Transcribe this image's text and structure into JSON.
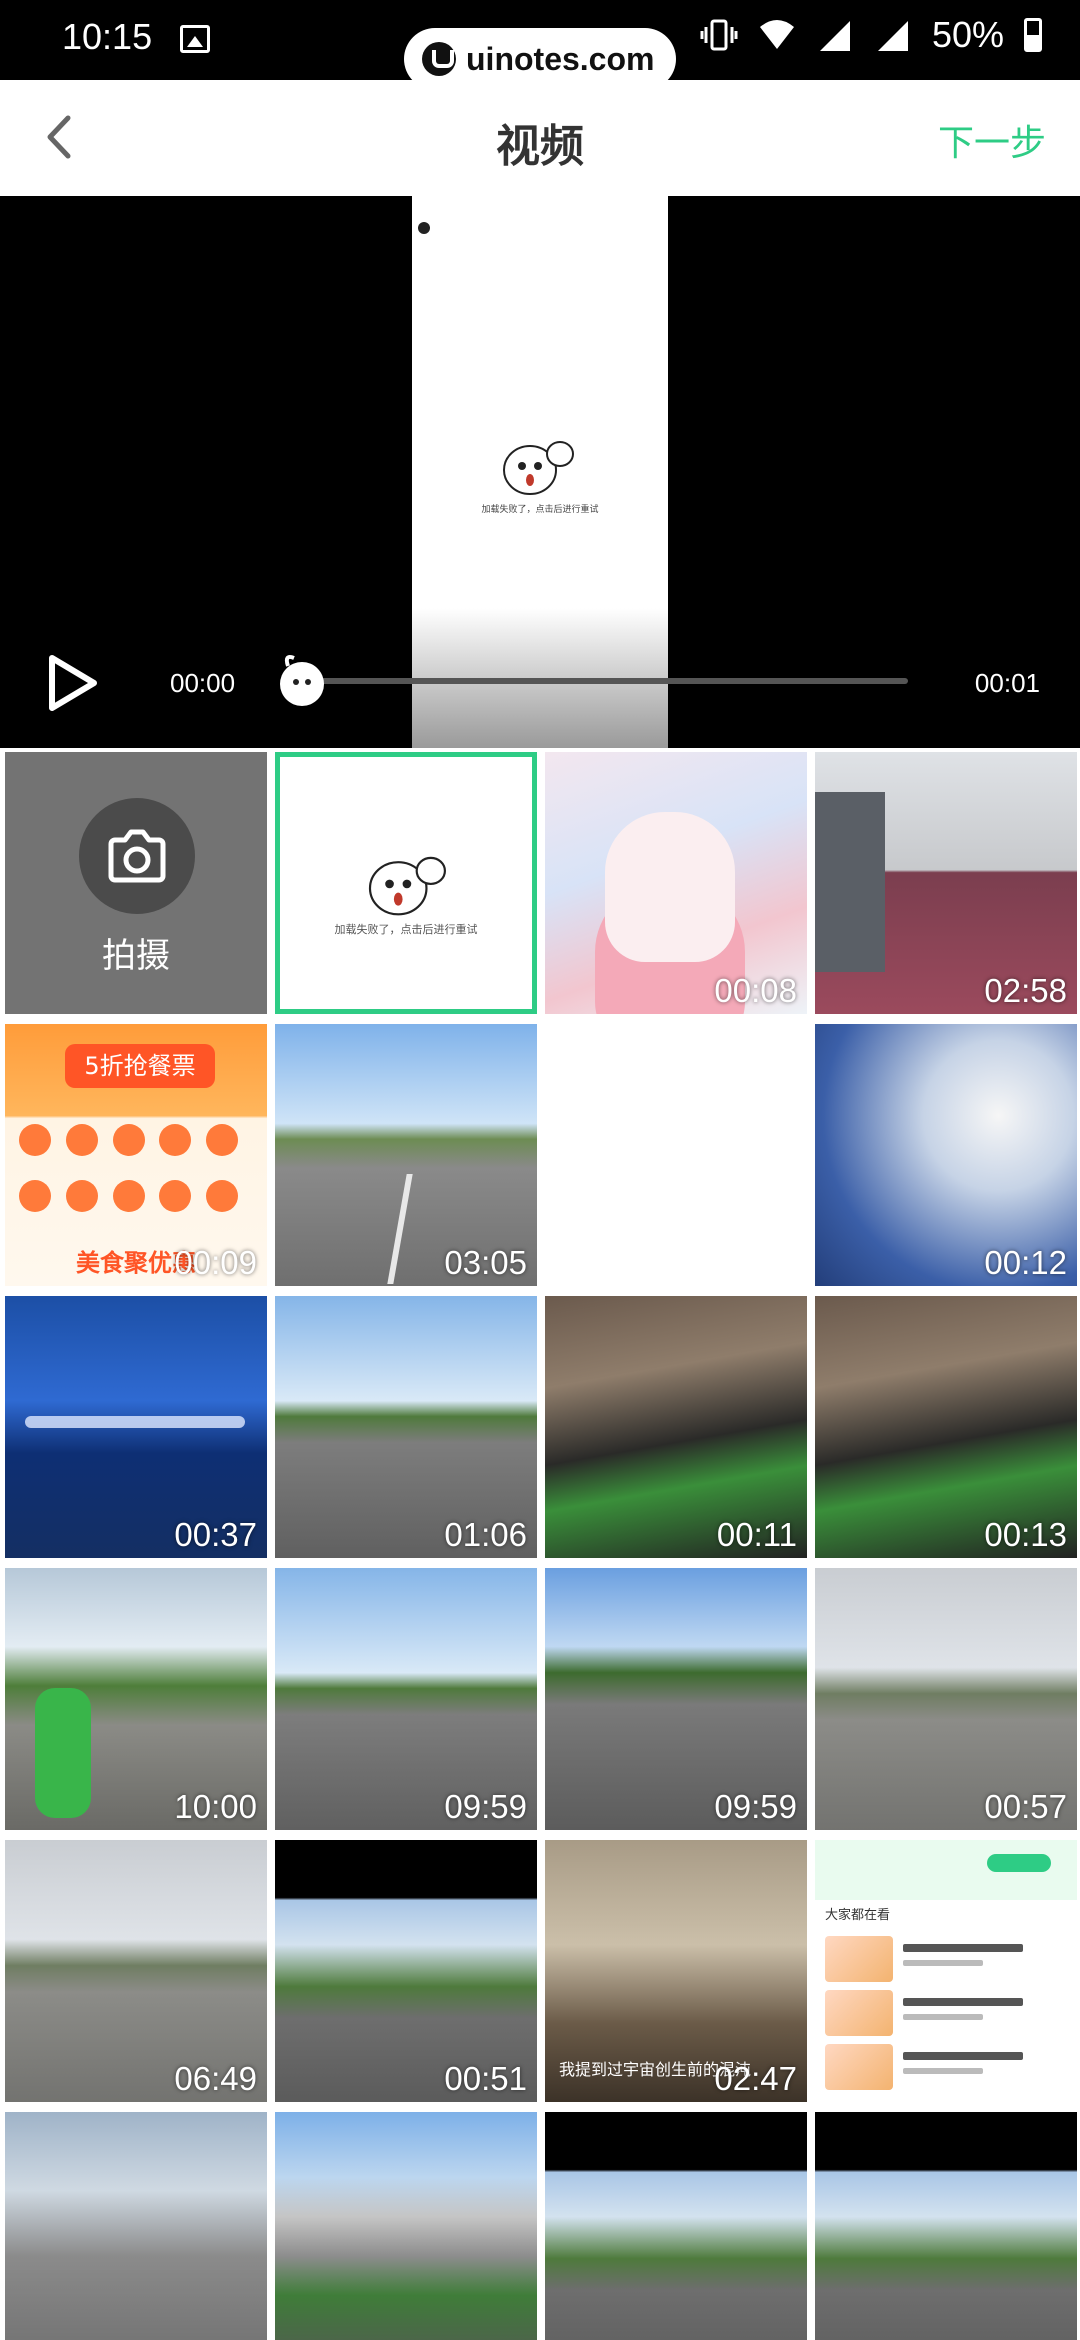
{
  "status_bar": {
    "time": "10:15",
    "battery": "50%",
    "watermark": "uinotes.com"
  },
  "header": {
    "back_icon": "chevron-left-icon",
    "title": "视频",
    "next_label": "下一步",
    "accent_color": "#2ecc85"
  },
  "player": {
    "current_time": "00:00",
    "total_time": "00:01",
    "progress": 0,
    "preview_caption": "加载失败了，点击后进行重试",
    "play_icon": "play-icon"
  },
  "grid": {
    "camera_label": "拍摄",
    "camera_icon": "camera-icon",
    "selected_caption": "加载失败了，点击后进行重试",
    "durations": [
      "00:08",
      "02:58",
      "00:09",
      "03:05",
      "",
      "00:12",
      "00:37",
      "01:06",
      "00:11",
      "00:13",
      "10:00",
      "09:59",
      "09:59",
      "00:57",
      "06:49",
      "00:51",
      "02:47",
      "",
      "",
      "",
      "",
      ""
    ],
    "promo_banner": "5折抢餐票",
    "promo_footer": "美食聚优惠",
    "lecture_subtitle": "我提到过宇宙创生前的混沌",
    "app_section_label": "大家都在看"
  }
}
